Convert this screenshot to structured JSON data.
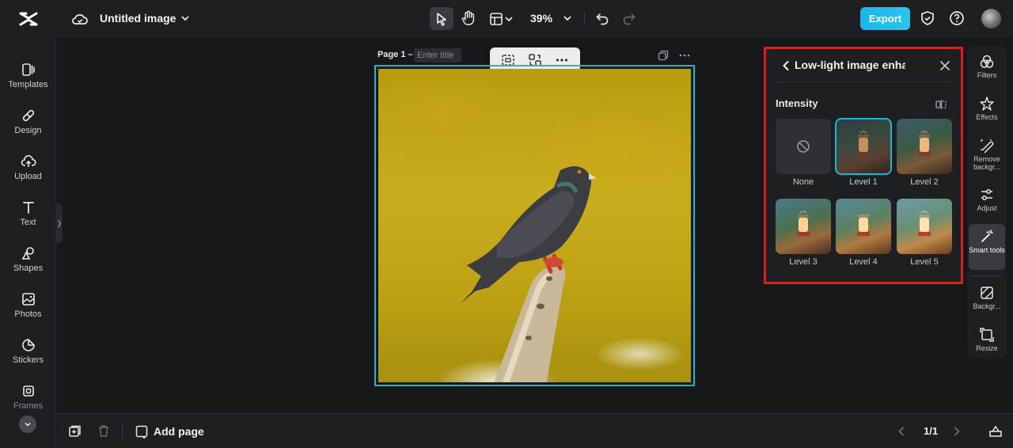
{
  "header": {
    "document_title": "Untitled image",
    "zoom": "39%",
    "export_label": "Export"
  },
  "sidebar": {
    "items": [
      {
        "label": "Templates",
        "icon": "templates-icon"
      },
      {
        "label": "Design",
        "icon": "design-icon"
      },
      {
        "label": "Upload",
        "icon": "upload-icon"
      },
      {
        "label": "Text",
        "icon": "text-icon"
      },
      {
        "label": "Shapes",
        "icon": "shapes-icon"
      },
      {
        "label": "Photos",
        "icon": "photos-icon"
      },
      {
        "label": "Stickers",
        "icon": "stickers-icon"
      },
      {
        "label": "Frames",
        "icon": "frames-icon"
      }
    ]
  },
  "canvas": {
    "page_label": "Page 1 –",
    "title_placeholder": "Enter title"
  },
  "panel": {
    "title": "Low-light image enhan...",
    "section_label": "Intensity",
    "selected_level": "Level 1",
    "levels": [
      {
        "label": "None"
      },
      {
        "label": "Level 1"
      },
      {
        "label": "Level 2"
      },
      {
        "label": "Level 3"
      },
      {
        "label": "Level 4"
      },
      {
        "label": "Level 5"
      }
    ]
  },
  "rail": {
    "items": [
      {
        "label": "Filters"
      },
      {
        "label": "Effects"
      },
      {
        "label": "Remove backgr..."
      },
      {
        "label": "Adjust"
      },
      {
        "label": "Smart tools"
      },
      {
        "label": "Backgr..."
      },
      {
        "label": "Resize"
      }
    ],
    "active": "Smart tools"
  },
  "bottom": {
    "add_page_label": "Add page",
    "page_counter": "1/1"
  },
  "colors": {
    "accent": "#1fb6d4",
    "highlight_border": "#e01b1b",
    "export_bg": "#19b5f0"
  }
}
